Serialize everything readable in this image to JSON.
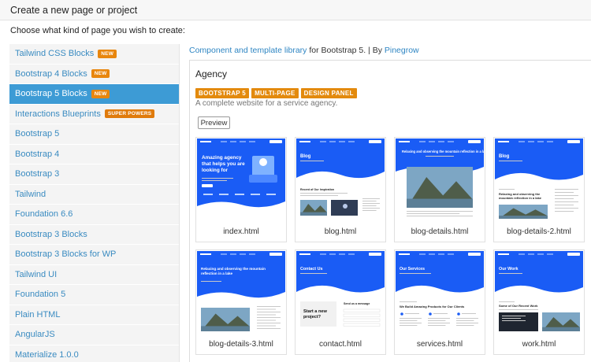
{
  "header": {
    "title": "Create a new page or project"
  },
  "subtitle": "Choose what kind of page you wish to create:",
  "sidebar": {
    "items": [
      {
        "label": "Tailwind CSS Blocks",
        "badge": "NEW"
      },
      {
        "label": "Bootstrap 4 Blocks",
        "badge": "NEW"
      },
      {
        "label": "Bootstrap 5 Blocks",
        "badge": "NEW",
        "active": true
      },
      {
        "label": "Interactions Blueprints",
        "badge": "SUPER POWERS"
      },
      {
        "label": "Bootstrap 5"
      },
      {
        "label": "Bootstrap 4"
      },
      {
        "label": "Bootstrap 3"
      },
      {
        "label": "Tailwind"
      },
      {
        "label": "Foundation 6.6"
      },
      {
        "label": "Bootstrap 3 Blocks"
      },
      {
        "label": "Bootstrap 3 Blocks for WP"
      },
      {
        "label": "Tailwind UI"
      },
      {
        "label": "Foundation 5"
      },
      {
        "label": "Plain HTML"
      },
      {
        "label": "AngularJS"
      },
      {
        "label": "Materialize 1.0.0"
      }
    ]
  },
  "library": {
    "link_text": "Component and template library",
    "middle_text": " for Bootstrap 5. | By ",
    "author_link": "Pinegrow"
  },
  "panel": {
    "title": "Agency",
    "tags": [
      "BOOTSTRAP 5",
      "MULTI-PAGE",
      "DESIGN PANEL"
    ],
    "description": "A complete website for a service agency.",
    "preview_label": "Preview"
  },
  "templates": [
    {
      "file": "index.html",
      "kind": "index"
    },
    {
      "file": "blog.html",
      "kind": "blog"
    },
    {
      "file": "blog-details.html",
      "kind": "blog-details"
    },
    {
      "file": "blog-details-2.html",
      "kind": "blog-details-2"
    },
    {
      "file": "blog-details-3.html",
      "kind": "blog-details-3"
    },
    {
      "file": "contact.html",
      "kind": "contact"
    },
    {
      "file": "services.html",
      "kind": "services"
    },
    {
      "file": "work.html",
      "kind": "work"
    }
  ],
  "thumb_text": {
    "index_headline": [
      "Amazing agency",
      "that helps you are",
      "looking for"
    ],
    "blog_title": "Blog",
    "blog_recent": "Recent of Our Inspiration",
    "details_title": [
      "Relaxing and observing the mountain reflection in a lake"
    ],
    "details2_heading": [
      "Relaxing and observing the",
      "mountain reflection in a lake"
    ],
    "details3_title": [
      "Relaxing and observing the mountain",
      "reflection in a lake"
    ],
    "contact_title": "Contact Us",
    "contact_card": [
      "Start a new",
      "project?"
    ],
    "contact_form": "Send us a message",
    "services_title": "Our Services",
    "services_heading": "We Build Amazing Products for Our Clients",
    "work_title": "Our Work",
    "work_heading": "Some of Our Recent Work",
    "brand": "Pinegrow"
  },
  "colors": {
    "accent": "#1a5cf5",
    "link": "#2f86c3",
    "active": "#3d9bd5",
    "badge": "#e8860e"
  }
}
